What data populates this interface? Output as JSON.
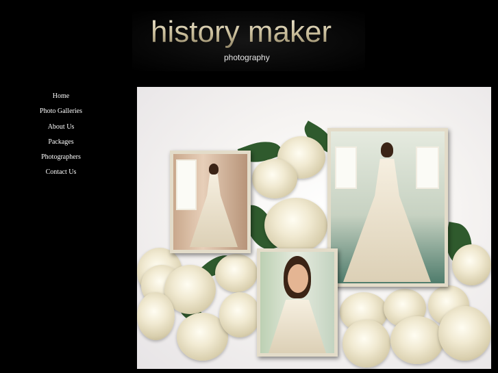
{
  "logo": {
    "title": "history maker",
    "subtitle": "photography"
  },
  "nav": [
    {
      "label": "Home"
    },
    {
      "label": "Photo Galleries"
    },
    {
      "label": "About Us"
    },
    {
      "label": "Packages"
    },
    {
      "label": "Photographers"
    },
    {
      "label": "Contact Us"
    }
  ]
}
